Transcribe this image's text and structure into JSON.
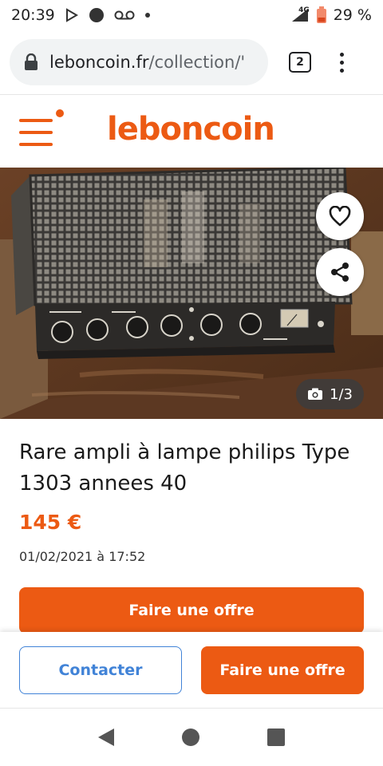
{
  "status_bar": {
    "time": "20:39",
    "network": "4G",
    "battery": "29 %",
    "icons": [
      "play-store-icon",
      "notification-dot-icon",
      "voicemail-icon",
      "more-dot-icon",
      "signal-icon",
      "battery-icon"
    ]
  },
  "browser": {
    "url_domain": "leboncoin.fr",
    "url_path": "/collection/'",
    "tab_count": "2"
  },
  "site": {
    "logo_text": "leboncoin",
    "brand_color": "#ec5a13"
  },
  "listing": {
    "photo_counter": "1/3",
    "title": "Rare ampli à lampe philips Type 1303 annees 40",
    "price": "145 €",
    "date": "01/02/2021 à 17:52",
    "offer_label": "Faire une offre"
  },
  "action_bar": {
    "contact_label": "Contacter",
    "offer_label": "Faire une offre",
    "contact_color": "#4183d7"
  }
}
